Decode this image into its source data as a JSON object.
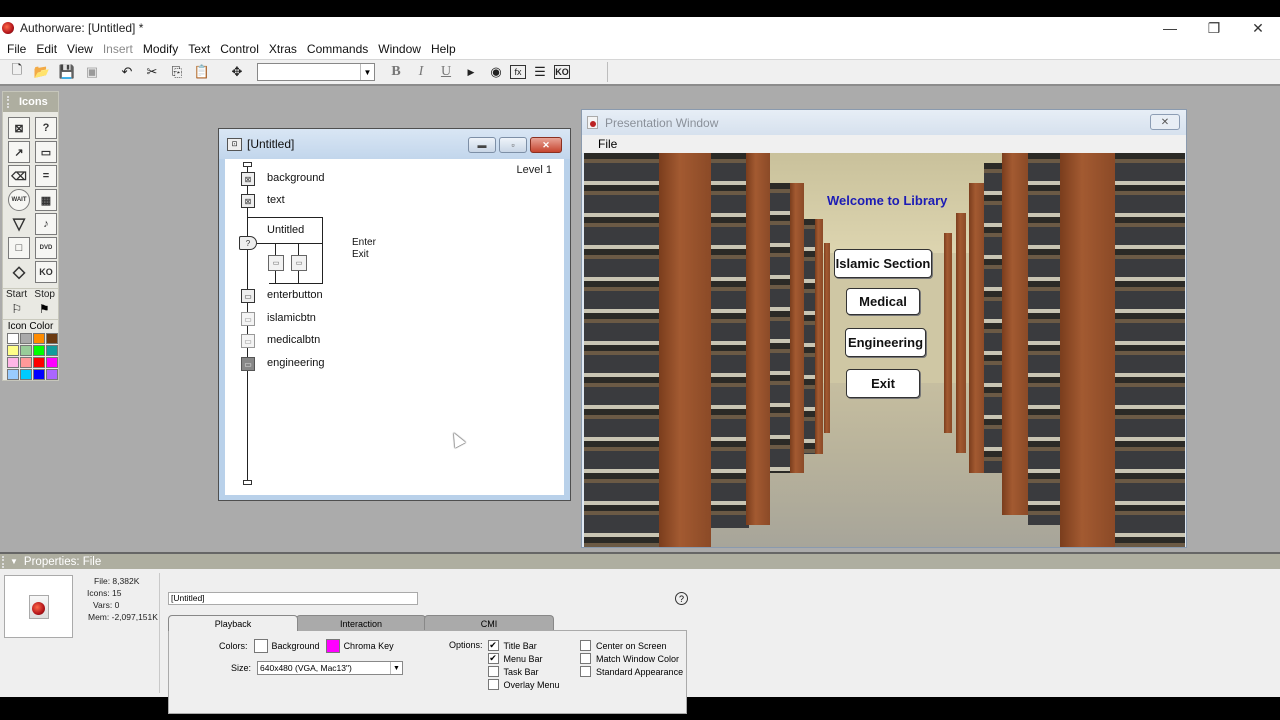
{
  "window": {
    "title": "Authorware: [Untitled] *",
    "controls": {
      "minimize": "—",
      "restore": "❐",
      "close": "✕"
    }
  },
  "menubar": [
    {
      "label": "File",
      "enabled": true
    },
    {
      "label": "Edit",
      "enabled": true
    },
    {
      "label": "View",
      "enabled": true
    },
    {
      "label": "Insert",
      "enabled": false
    },
    {
      "label": "Modify",
      "enabled": true
    },
    {
      "label": "Text",
      "enabled": true
    },
    {
      "label": "Control",
      "enabled": true
    },
    {
      "label": "Xtras",
      "enabled": true
    },
    {
      "label": "Commands",
      "enabled": true
    },
    {
      "label": "Window",
      "enabled": true
    },
    {
      "label": "Help",
      "enabled": true
    }
  ],
  "toolbar": {
    "buttons": [
      {
        "name": "new-file-icon",
        "glyph": "🗋",
        "enabled": true
      },
      {
        "name": "open-file-icon",
        "glyph": "📂",
        "enabled": true
      },
      {
        "name": "save-all-icon",
        "glyph": "💾",
        "enabled": true
      },
      {
        "name": "import-icon",
        "glyph": "▣",
        "enabled": false
      },
      {
        "name": "undo-icon",
        "glyph": "↶",
        "enabled": true
      },
      {
        "name": "cut-icon",
        "glyph": "✂",
        "enabled": true
      },
      {
        "name": "copy-icon",
        "glyph": "⎘",
        "enabled": true
      },
      {
        "name": "paste-icon",
        "glyph": "📋",
        "enabled": false
      },
      {
        "name": "find-icon",
        "glyph": "✥",
        "enabled": true
      }
    ],
    "font_value": "",
    "style_buttons": [
      {
        "name": "bold-button",
        "glyph": "B"
      },
      {
        "name": "italic-button",
        "glyph": "I"
      },
      {
        "name": "underline-button",
        "glyph": "U"
      }
    ],
    "right_buttons": [
      {
        "name": "restart-icon",
        "glyph": "▶"
      },
      {
        "name": "control-panel-icon",
        "glyph": "◉"
      },
      {
        "name": "functions-icon",
        "glyph": "fx"
      },
      {
        "name": "variables-icon",
        "glyph": "☰"
      },
      {
        "name": "knowledge-objects-icon",
        "glyph": "KO"
      }
    ]
  },
  "icons_palette": {
    "title": "Icons",
    "icons": [
      {
        "name": "display-icon",
        "glyph": "⊠"
      },
      {
        "name": "decision-icon",
        "glyph": "?"
      },
      {
        "name": "motion-icon",
        "glyph": "↗"
      },
      {
        "name": "interaction-icon",
        "glyph": "▭"
      },
      {
        "name": "erase-icon",
        "glyph": "⌫"
      },
      {
        "name": "calculation-icon",
        "glyph": "="
      },
      {
        "name": "wait-icon",
        "glyph": "WAIT"
      },
      {
        "name": "digital-movie-icon",
        "glyph": "▦"
      },
      {
        "name": "navigate-icon",
        "glyph": "▽"
      },
      {
        "name": "sound-icon",
        "glyph": "♪"
      },
      {
        "name": "framework-icon",
        "glyph": "□"
      },
      {
        "name": "video-icon",
        "glyph": "DVD"
      },
      {
        "name": "map-icon",
        "glyph": "◇"
      },
      {
        "name": "knowledge-object-icon",
        "glyph": "KO"
      }
    ],
    "start_label": "Start",
    "stop_label": "Stop",
    "icon_color_label": "Icon Color",
    "colors": [
      "#ffffff",
      "#aaaaaa",
      "#ff8c00",
      "#6b3a10",
      "#ffff88",
      "#99cc99",
      "#00ff00",
      "#139c9c",
      "#ffb6e6",
      "#ff9999",
      "#ff0000",
      "#ff00ff",
      "#99ccff",
      "#00ccff",
      "#0000ff",
      "#aa66ff"
    ]
  },
  "flowline": {
    "title": "[Untitled]",
    "level": "Level 1",
    "items": [
      {
        "label": "background",
        "type": "display"
      },
      {
        "label": "text",
        "type": "display"
      },
      {
        "label": "Untitled",
        "type": "interaction"
      },
      {
        "label": "enterbutton",
        "type": "calculation"
      },
      {
        "label": "islamicbtn",
        "type": "calculation"
      },
      {
        "label": "medicalbtn",
        "type": "calculation"
      },
      {
        "label": "engineering",
        "type": "calculation"
      }
    ],
    "branches": [
      "Enter",
      "Exit"
    ]
  },
  "presentation": {
    "title": "Presentation Window",
    "menu_file": "File",
    "welcome": "Welcome to Library",
    "buttons": [
      "Islamic Section",
      "Medical",
      "Engineering",
      "Exit"
    ]
  },
  "properties": {
    "header": "Properties: File",
    "stats": {
      "file": "File: 8,382K",
      "icons": "Icons: 15",
      "vars": "Vars: 0",
      "mem": "Mem: -2,097,151K"
    },
    "name_value": "[Untitled]",
    "tabs": [
      "Playback",
      "Interaction",
      "CMI"
    ],
    "active_tab": "Playback",
    "colors_label": "Colors:",
    "background_label": "Background",
    "background_color": "#ffffff",
    "chroma_label": "Chroma Key",
    "chroma_color": "#ff00ff",
    "size_label": "Size:",
    "size_value": "640x480 (VGA, Mac13\")",
    "options_label": "Options:",
    "options_left": [
      {
        "label": "Title Bar",
        "checked": true
      },
      {
        "label": "Menu Bar",
        "checked": true
      },
      {
        "label": "Task Bar",
        "checked": false
      },
      {
        "label": "Overlay Menu",
        "checked": false
      }
    ],
    "options_right": [
      {
        "label": "Center on Screen",
        "checked": false
      },
      {
        "label": "Match Window Color",
        "checked": false
      },
      {
        "label": "Standard Appearance",
        "checked": false
      }
    ]
  }
}
